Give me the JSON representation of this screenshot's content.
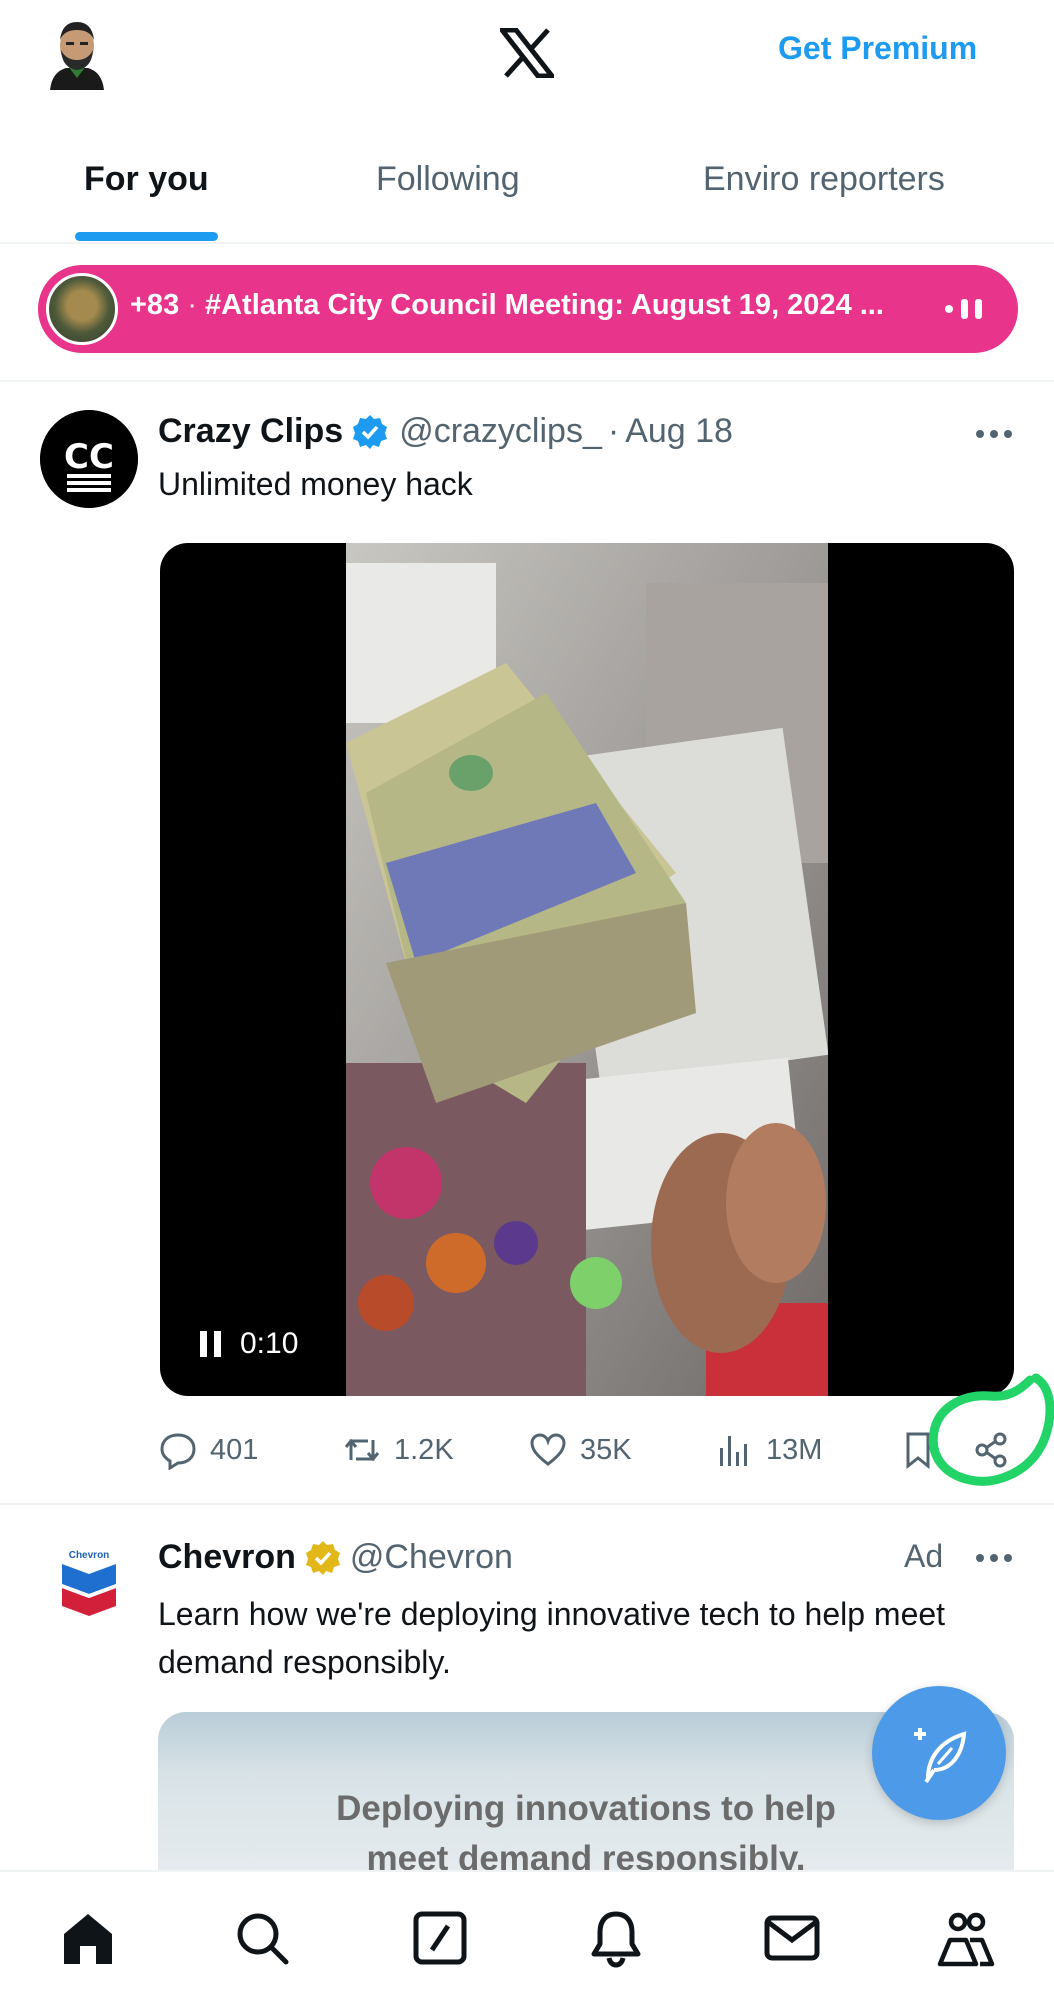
{
  "header": {
    "logo_icon": "x-logo-icon",
    "premium_label": "Get Premium"
  },
  "tabs": [
    {
      "label": "For you",
      "active": true
    },
    {
      "label": "Following",
      "active": false
    },
    {
      "label": "Enviro reporters",
      "active": false
    }
  ],
  "spaces_banner": {
    "count": "+83",
    "title": "#Atlanta City Council Meeting: August 19, 2024 ...",
    "color": "#e8348a"
  },
  "tweet": {
    "author_name": "Crazy Clips",
    "handle": "@crazyclips_",
    "date": "Aug 18",
    "text": "Unlimited money hack",
    "video_time": "0:10",
    "stats": {
      "replies": "401",
      "reposts": "1.2K",
      "likes": "35K",
      "views": "13M"
    }
  },
  "ad": {
    "author_name": "Chevron",
    "handle": "@Chevron",
    "label": "Ad",
    "text": "Learn how we're deploying innovative tech to help meet demand responsibly.",
    "card_title_line1": "Deploying innovations to help",
    "card_title_line2": "meet demand responsibly."
  },
  "bottom_nav": [
    "home-icon",
    "search-icon",
    "grok-icon",
    "notifications-icon",
    "messages-icon",
    "communities-icon"
  ],
  "colors": {
    "accent": "#1d9bf0",
    "highlight": "#22d468"
  }
}
